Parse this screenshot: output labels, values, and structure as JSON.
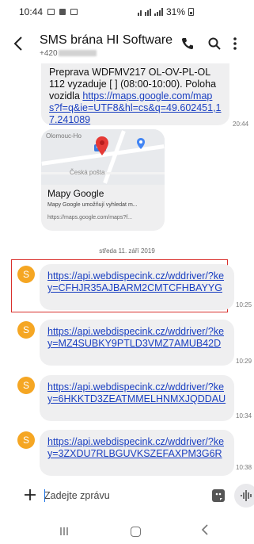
{
  "status_bar": {
    "time": "10:44",
    "battery": "31%"
  },
  "header": {
    "title": "SMS brána HI Software",
    "number_prefix": "+420"
  },
  "messages": [
    {
      "text": "Preprava WDFMV217 OL-OV-PL-OL 112 vyzaduje [ ] (08:00-10:00). Poloha vozidla ",
      "link": "https://maps.google.com/maps?f=q&ie=UTF8&hl=cs&q=49.602451,17.241089",
      "time": "20:44"
    }
  ],
  "link_preview": {
    "map_town": "Olomouc-Ho",
    "map_shield": "635",
    "map_place": "Česká pošta",
    "title": "Mapy Google",
    "description": "Mapy Google umožňují vyhledat m...",
    "url": "https://maps.google.com/maps?f..."
  },
  "date_separator": "středa 11. září 2019",
  "incoming": [
    {
      "avatar_letter": "S",
      "link": "https://api.webdispecink.cz/wddriver/?key=CFHJR35AJBARM2CMTCFHBAYYG",
      "time": "10:25"
    },
    {
      "avatar_letter": "S",
      "link": "https://api.webdispecink.cz/wddriver/?key=MZ4SUBKY9PTLD3VMZ7AMUB42D",
      "time": "10:29"
    },
    {
      "avatar_letter": "S",
      "link": "https://api.webdispecink.cz/wddriver/?key=6HKKTD3ZEATMMELHNMXJQDDAU",
      "time": "10:34"
    },
    {
      "avatar_letter": "S",
      "link": "https://api.webdispecink.cz/wddriver/?key=3ZXDU7RLBGUVKSZEFAXPM3G6R",
      "time": "10:38"
    }
  ],
  "composer": {
    "placeholder": "Zadejte zprávu"
  },
  "colors": {
    "link": "#1a3fc1",
    "avatar": "#f5a623",
    "highlight": "#d9302c",
    "bubble": "#efeff0"
  }
}
